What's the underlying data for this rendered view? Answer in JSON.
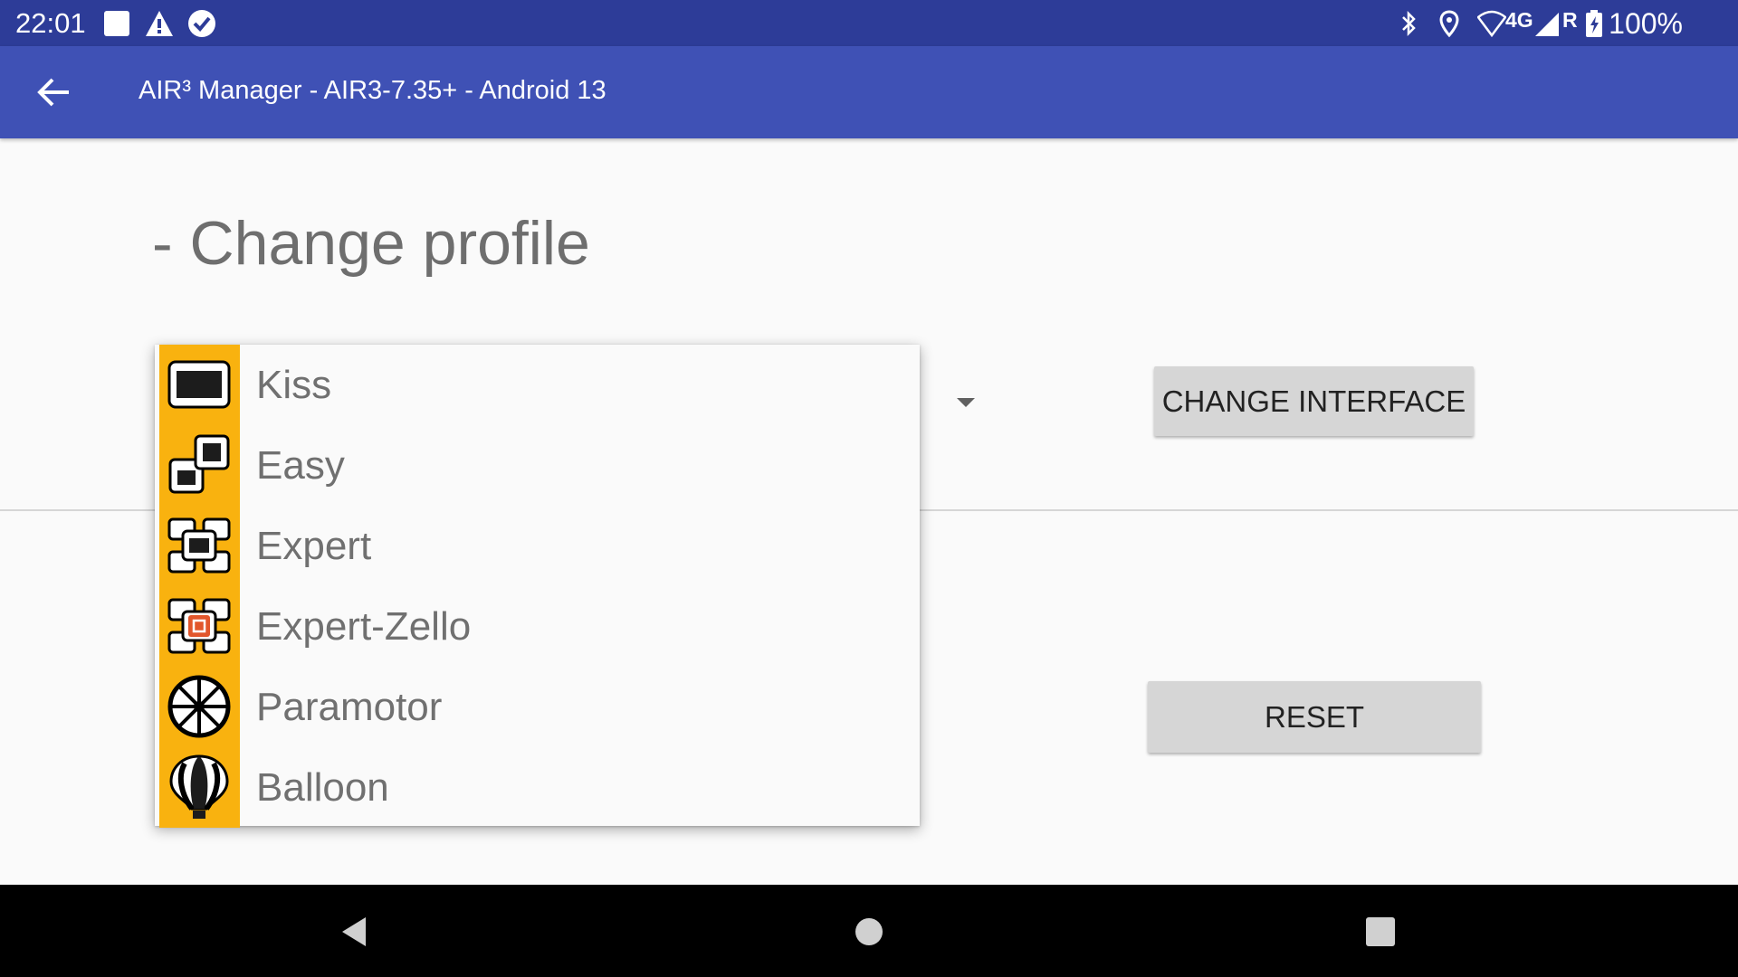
{
  "status_bar": {
    "time": "22:01",
    "network_label": "4G",
    "roaming_label": "R",
    "battery": "100%",
    "icons": [
      "notification-square-icon",
      "warning-icon",
      "check-circle-icon",
      "bluetooth-icon",
      "location-icon",
      "wifi-icon",
      "signal-icon",
      "battery-icon"
    ]
  },
  "app_bar": {
    "title": "AIR³ Manager - AIR3-7.35+ - Android 13",
    "back_icon": "arrow-left-icon"
  },
  "main": {
    "section_title": "- Change profile",
    "change_interface_label": "CHANGE INTERFACE",
    "reset_label": "RESET"
  },
  "dropdown": {
    "items": [
      {
        "label": "Kiss",
        "icon": "kiss-profile-icon"
      },
      {
        "label": "Easy",
        "icon": "easy-profile-icon"
      },
      {
        "label": "Expert",
        "icon": "expert-profile-icon"
      },
      {
        "label": "Expert-Zello",
        "icon": "expert-zello-profile-icon"
      },
      {
        "label": "Paramotor",
        "icon": "paramotor-profile-icon"
      },
      {
        "label": "Balloon",
        "icon": "balloon-profile-icon"
      }
    ]
  },
  "nav_bar": {
    "icons": [
      "back-triangle-icon",
      "home-circle-icon",
      "recents-square-icon"
    ]
  },
  "colors": {
    "status_bar": "#2d3c98",
    "app_bar": "#3f51b5",
    "profile_icon_bg": "#f9b20f",
    "zello_accent": "#e2562b"
  }
}
